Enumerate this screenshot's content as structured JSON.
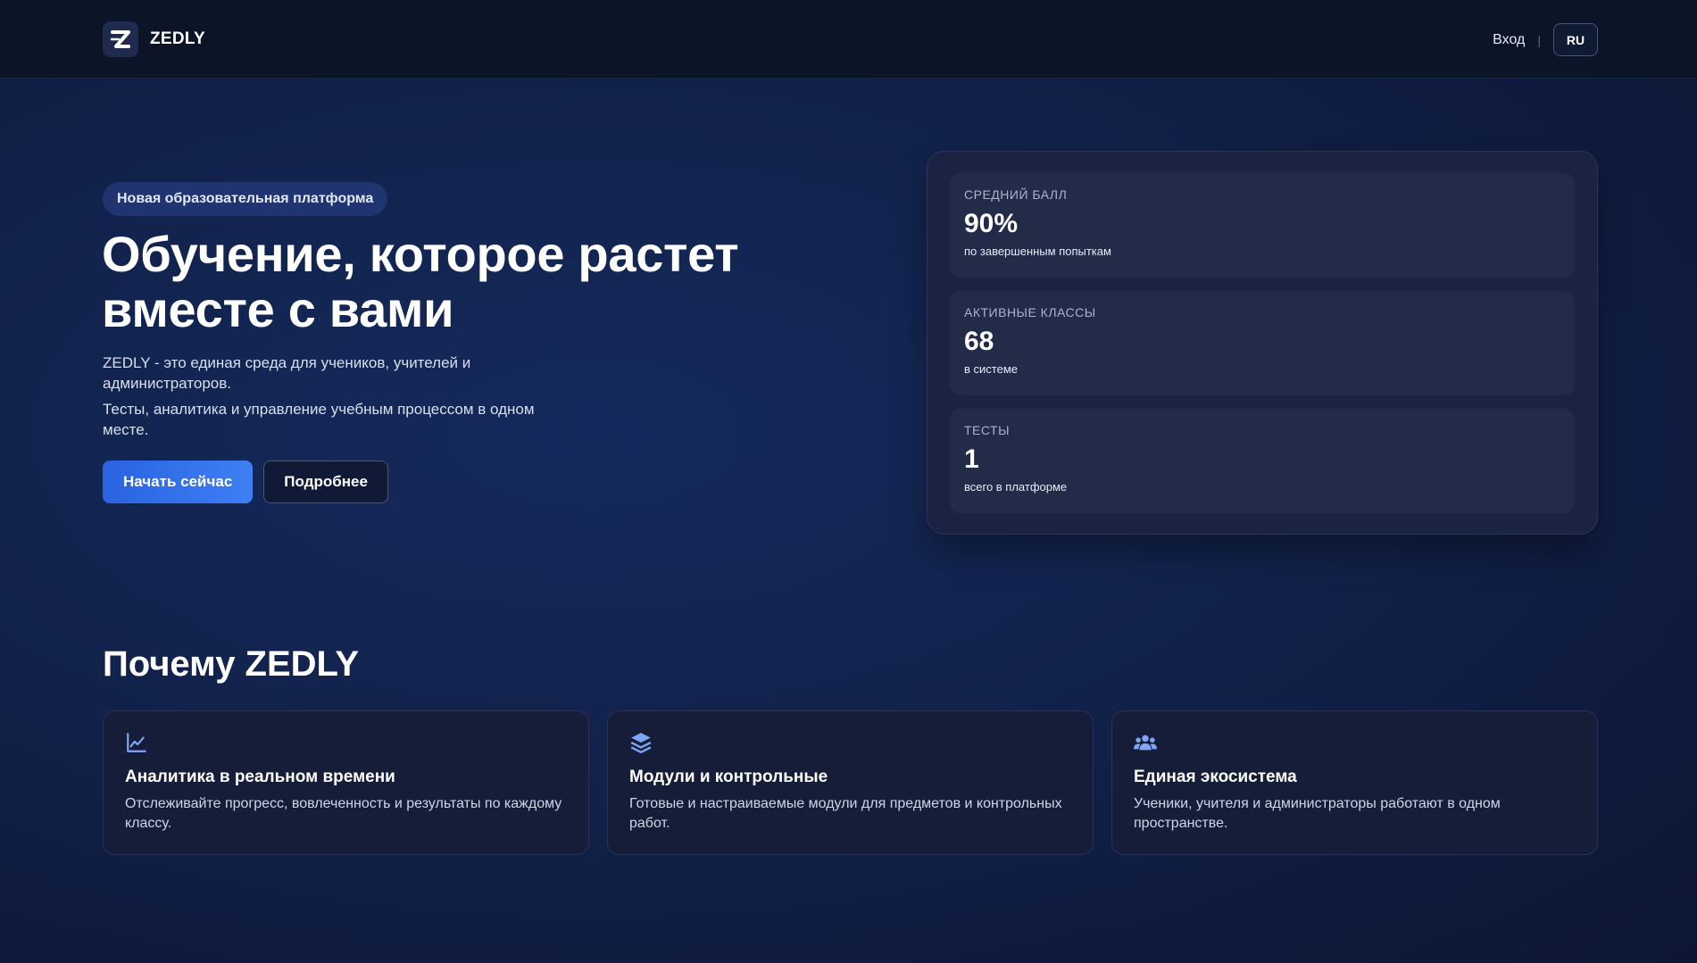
{
  "header": {
    "brand": "ZEDLY",
    "login_label": "Вход",
    "separator": "|",
    "language": "RU"
  },
  "hero": {
    "badge": "Новая образовательная платформа",
    "title_line1": "Обучение, которое растет",
    "title_line2": "вместе с вами",
    "description_1": "ZEDLY - это единая среда для учеников, учителей и администраторов.",
    "description_2": "Тесты, аналитика и управление учебным процессом в одном месте.",
    "primary_button": "Начать сейчас",
    "secondary_button": "Подробнее"
  },
  "stats": [
    {
      "label": "СРЕДНИЙ БАЛЛ",
      "value": "90%",
      "sub": "по завершенным попыткам"
    },
    {
      "label": "АКТИВНЫЕ КЛАССЫ",
      "value": "68",
      "sub": "в системе"
    },
    {
      "label": "ТЕСТЫ",
      "value": "1",
      "sub": "всего в платформе"
    }
  ],
  "why": {
    "title": "Почему ZEDLY",
    "features": [
      {
        "icon": "chart-line-icon",
        "title": "Аналитика в реальном времени",
        "desc": "Отслеживайте прогресс, вовлеченность и результаты по каждому классу."
      },
      {
        "icon": "layers-icon",
        "title": "Модули и контрольные",
        "desc": "Готовые и настраиваемые модули для предметов и контрольных работ."
      },
      {
        "icon": "users-icon",
        "title": "Единая экосистема",
        "desc": "Ученики, учителя и администраторы работают в одном пространстве."
      }
    ]
  },
  "colors": {
    "accent": "#3d7ff5",
    "background": "#12244f",
    "card": "#1a2342",
    "icon": "#7fa6f5"
  }
}
